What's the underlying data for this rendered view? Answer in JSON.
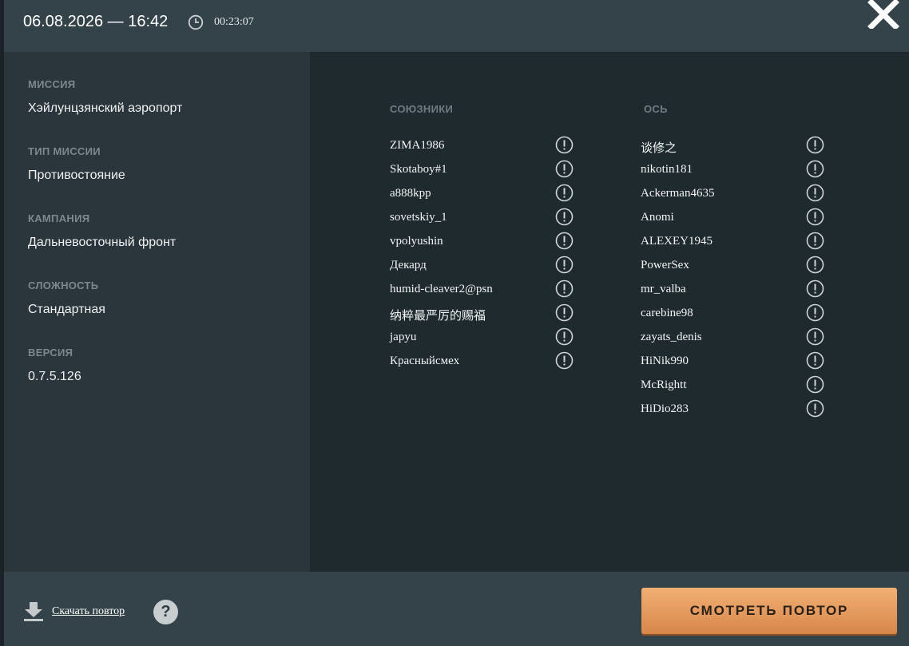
{
  "header": {
    "datetime": "06.08.2026 — 16:42",
    "duration": "00:23:07",
    "clock_icon": "clock-icon",
    "close_icon": "close-icon"
  },
  "info": {
    "mission_label": "МИССИЯ",
    "mission_value": "Хэйлунцзянский аэропорт",
    "mission_type_label": "ТИП МИССИИ",
    "mission_type_value": "Противостояние",
    "campaign_label": "КАМПАНИЯ",
    "campaign_value": "Дальневосточный фронт",
    "difficulty_label": "СЛОЖНОСТЬ",
    "difficulty_value": "Стандартная",
    "version_label": "ВЕРСИЯ",
    "version_value": "0.7.5.126"
  },
  "allies": {
    "title": "СОЮЗНИКИ",
    "players": [
      "ZIMA1986",
      "Skotaboy#1",
      "a888kpp",
      "sovetskiy_1",
      "vpolyushin",
      "Декард",
      "humid-cleaver2@psn",
      "纳粹最严厉的赐福",
      "japyu",
      "Красныйсмех"
    ]
  },
  "axis": {
    "title": "ОСЬ",
    "players": [
      "谈修之",
      "nikotin181",
      "Ackerman4635",
      "Anomi",
      "ALEXEY1945",
      "PowerSex",
      "mr_valba",
      "carebine98",
      "zayats_denis",
      "HiNik990",
      "McRightt",
      "HiDio283"
    ]
  },
  "footer": {
    "download_label": "Скачать повтор",
    "help_label": "?",
    "watch_label": "СМОТРЕТЬ ПОВТОР"
  },
  "colors": {
    "header_bg": "#34434a",
    "info_bg": "#2a363b",
    "players_bg": "#1f2a2f",
    "accent_button": "#e39a5c"
  }
}
